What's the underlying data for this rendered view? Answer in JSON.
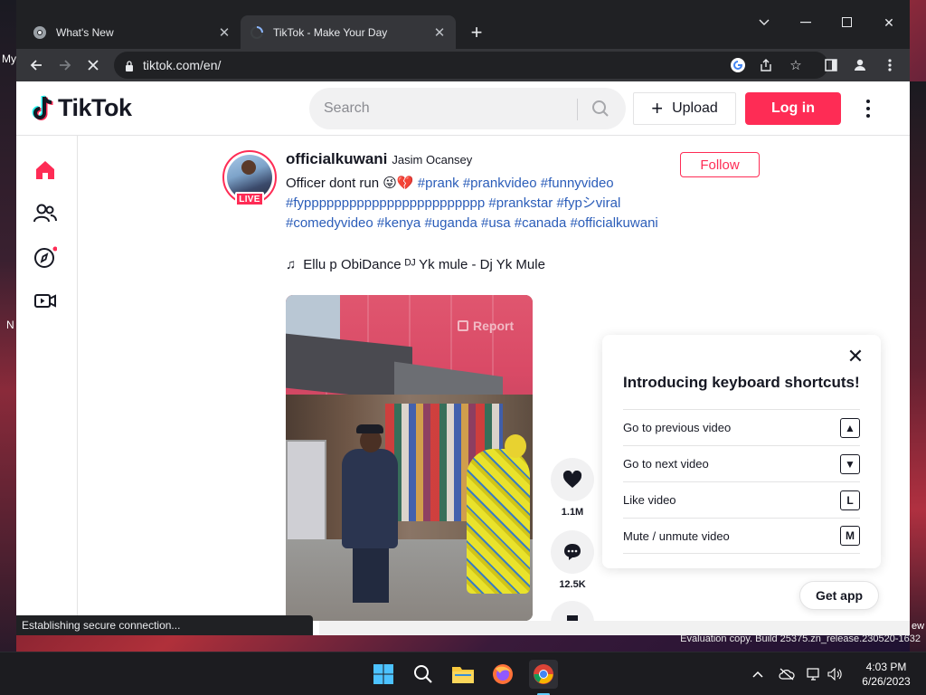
{
  "desktop": {
    "left_text_1": "My",
    "left_text_2": "N",
    "right_text": "ew",
    "evaluation": "Evaluation copy. Build 25375.zn_release.230520-1632"
  },
  "browser": {
    "tabs": [
      {
        "title": "What's New",
        "icon": "chrome-icon"
      },
      {
        "title": "TikTok - Make Your Day",
        "icon": "loading-spinner-icon"
      }
    ],
    "url": "tiktok.com/en/",
    "status": "Establishing secure connection..."
  },
  "tiktok": {
    "logo_text": "TikTok",
    "search_placeholder": "Search",
    "upload_label": "Upload",
    "login_label": "Log in",
    "post": {
      "author_id": "officialkuwani",
      "author_nick": "Jasim Ocansey",
      "live_label": "LIVE",
      "follow_label": "Follow",
      "caption_text": "Officer dont run",
      "caption_emoji": "😜💔",
      "hashtags": [
        "#prank",
        "#prankvideo",
        "#funnyvideo",
        "#fypppppppppppppppppppppppp",
        "#prankstar",
        "#fypシviral",
        "#comedyvideo",
        "#kenya",
        "#uganda",
        "#usa",
        "#canada",
        "#officialkuwani"
      ],
      "music": "Ellu p ObiDance ᴰᴶ Yk mule - Dj Yk Mule",
      "report_label": "Report",
      "likes": "1.1M",
      "comments": "12.5K"
    },
    "shortcuts": {
      "title": "Introducing keyboard shortcuts!",
      "items": [
        {
          "label": "Go to previous video",
          "key": "▲"
        },
        {
          "label": "Go to next video",
          "key": "▼"
        },
        {
          "label": "Like video",
          "key": "L"
        },
        {
          "label": "Mute / unmute video",
          "key": "M"
        }
      ]
    },
    "get_app_label": "Get app"
  },
  "taskbar": {
    "time": "4:03 PM",
    "date": "6/26/2023"
  },
  "colors": {
    "brand": "#fe2c55",
    "hashtag": "#2b5db9",
    "chrome_dark": "#202124"
  }
}
